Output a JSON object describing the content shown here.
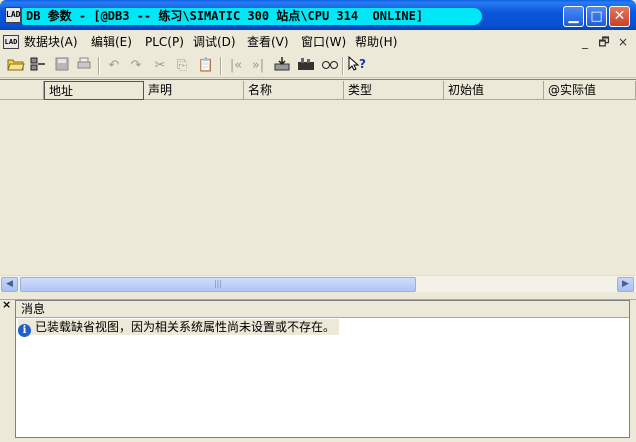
{
  "window": {
    "title": "DB 参数 - [@DB3 -- 练习\\SIMATIC 300 站点\\CPU 314  ONLINE]",
    "app_icon_text": "LAD",
    "min_glyph": "▁",
    "max_glyph": "□",
    "close_glyph": "✕"
  },
  "menu": {
    "items": [
      "数据块(A)",
      "编辑(E)",
      "PLC(P)",
      "调试(D)",
      "查看(V)",
      "窗口(W)",
      "帮助(H)"
    ],
    "mdi_min": "_",
    "mdi_restore": "🗗",
    "mdi_close": "×"
  },
  "toolbar": {
    "icons": [
      "open-folder-icon",
      "online-icon",
      "save-icon",
      "print-icon",
      "undo-icon",
      "redo-icon",
      "cut-icon",
      "copy-icon",
      "paste-icon",
      "first-icon",
      "last-icon",
      "download-icon",
      "monitor-icon",
      "glasses-icon",
      "help-icon"
    ]
  },
  "table": {
    "columns": [
      "地址",
      "声明",
      "名称",
      "类型",
      "初始值",
      "@实际值"
    ]
  },
  "messages": {
    "header": "消息",
    "rows": [
      "已装载缺省视图，因为相关系统属性尚未设置或不存在。"
    ],
    "close_glyph": "×"
  },
  "colors": {
    "title_bar": "#0b56da",
    "title_highlight": "#00e8f8",
    "info_icon": "#1f5fd0"
  }
}
